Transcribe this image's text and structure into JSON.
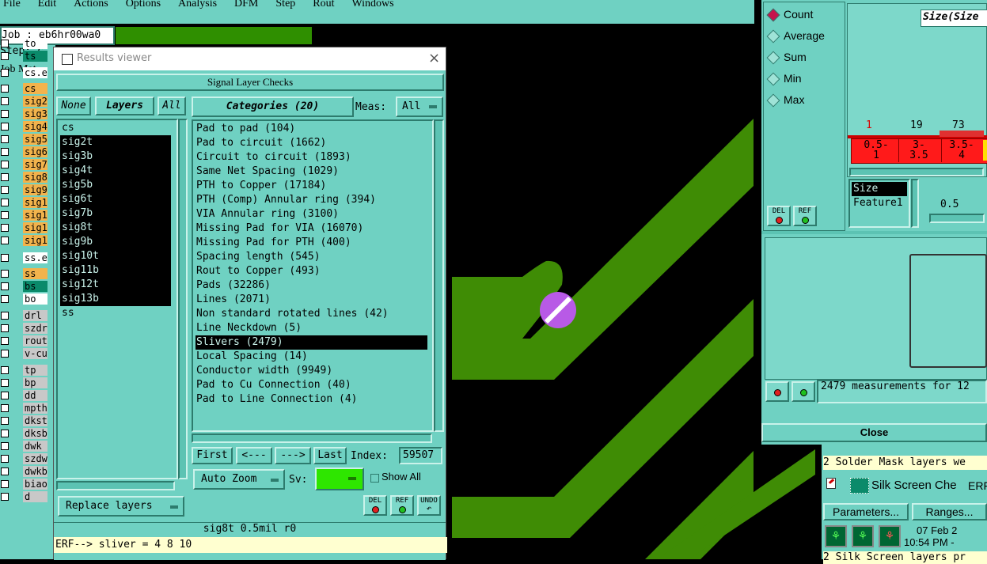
{
  "menu": [
    "File",
    "Edit",
    "Actions",
    "Options",
    "Analysis",
    "DFM",
    "Step",
    "Rout",
    "Windows"
  ],
  "job_label": "Job : eb6hr00wa0",
  "step_label": "Step: c",
  "job_matrix_label": "Job Mat",
  "left_layers": [
    {
      "name": "to",
      "color": "#ffffff"
    },
    {
      "name": "ts",
      "color": "#0a8a6a"
    },
    {
      "name": "cs.e",
      "color": "#ffffff"
    },
    {
      "name": "cs",
      "color": "#f2b34c"
    },
    {
      "name": "sig2",
      "color": "#f2b34c"
    },
    {
      "name": "sig3",
      "color": "#f2b34c"
    },
    {
      "name": "sig4",
      "color": "#f2b34c"
    },
    {
      "name": "sig5",
      "color": "#f2b34c"
    },
    {
      "name": "sig6",
      "color": "#f2b34c"
    },
    {
      "name": "sig7",
      "color": "#f2b34c"
    },
    {
      "name": "sig8",
      "color": "#f2b34c"
    },
    {
      "name": "sig9",
      "color": "#f2b34c"
    },
    {
      "name": "sig1",
      "color": "#f2b34c"
    },
    {
      "name": "sig1",
      "color": "#f2b34c"
    },
    {
      "name": "sig1",
      "color": "#f2b34c"
    },
    {
      "name": "sig1",
      "color": "#f2b34c"
    },
    {
      "name": "ss.e",
      "color": "#ffffff"
    },
    {
      "name": "ss",
      "color": "#f2b34c"
    },
    {
      "name": "bs",
      "color": "#0a8a6a"
    },
    {
      "name": "bo",
      "color": "#ffffff"
    },
    {
      "name": "drl",
      "color": "#c8c8c8"
    },
    {
      "name": "szdr",
      "color": "#c8c8c8"
    },
    {
      "name": "rout",
      "color": "#c8c8c8"
    },
    {
      "name": "v-cu",
      "color": "#c8c8c8"
    },
    {
      "name": "tp",
      "color": "#c8c8c8"
    },
    {
      "name": "bp",
      "color": "#c8c8c8"
    },
    {
      "name": "dd",
      "color": "#c8c8c8"
    },
    {
      "name": "mpth",
      "color": "#c8c8c8"
    },
    {
      "name": "dkst",
      "color": "#c8c8c8"
    },
    {
      "name": "dksb",
      "color": "#c8c8c8"
    },
    {
      "name": "dwk",
      "color": "#c8c8c8"
    },
    {
      "name": "szdw",
      "color": "#c8c8c8"
    },
    {
      "name": "dwkb",
      "color": "#c8c8c8"
    },
    {
      "name": "biao",
      "color": "#c8c8c8"
    },
    {
      "name": "d",
      "color": "#c8c8c8"
    }
  ],
  "results_viewer": {
    "title": "Results viewer",
    "header": "Signal Layer Checks",
    "none_btn": "None",
    "layers_btn": "Layers",
    "all_btn": "All",
    "layers": [
      {
        "name": "cs",
        "sel": false
      },
      {
        "name": "sig2t",
        "sel": true
      },
      {
        "name": "sig3b",
        "sel": true
      },
      {
        "name": "sig4t",
        "sel": true
      },
      {
        "name": "sig5b",
        "sel": true
      },
      {
        "name": "sig6t",
        "sel": true
      },
      {
        "name": "sig7b",
        "sel": true
      },
      {
        "name": "sig8t",
        "sel": true
      },
      {
        "name": "sig9b",
        "sel": true
      },
      {
        "name": "sig10t",
        "sel": true
      },
      {
        "name": "sig11b",
        "sel": true
      },
      {
        "name": "sig12t",
        "sel": true
      },
      {
        "name": "sig13b",
        "sel": true
      },
      {
        "name": "ss",
        "sel": false
      }
    ],
    "categories_label": "Categories (20)",
    "meas_label": "Meas:",
    "meas_value": "All",
    "categories": [
      {
        "name": "Pad to pad (104)",
        "sel": false
      },
      {
        "name": "Pad to circuit (1662)",
        "sel": false
      },
      {
        "name": "Circuit to circuit (1893)",
        "sel": false
      },
      {
        "name": "Same Net Spacing (1029)",
        "sel": false
      },
      {
        "name": "PTH to Copper (17184)",
        "sel": false
      },
      {
        "name": "PTH (Comp) Annular ring (394)",
        "sel": false
      },
      {
        "name": "VIA Annular ring (3100)",
        "sel": false
      },
      {
        "name": "Missing Pad for VIA (16070)",
        "sel": false
      },
      {
        "name": "Missing Pad for PTH (400)",
        "sel": false
      },
      {
        "name": "Spacing length (545)",
        "sel": false
      },
      {
        "name": "Rout to Copper (493)",
        "sel": false
      },
      {
        "name": "Pads (32286)",
        "sel": false
      },
      {
        "name": "Lines (2071)",
        "sel": false
      },
      {
        "name": "Non standard rotated lines (42)",
        "sel": false
      },
      {
        "name": "Line Neckdown (5)",
        "sel": false
      },
      {
        "name": "Slivers (2479)",
        "sel": true
      },
      {
        "name": "Local Spacing (14)",
        "sel": false
      },
      {
        "name": "Conductor width (9949)",
        "sel": false
      },
      {
        "name": "Pad to Cu Connection (40)",
        "sel": false
      },
      {
        "name": "Pad to Line Connection (4)",
        "sel": false
      }
    ],
    "first_btn": "First",
    "prev_btn": "<---",
    "next_btn": "--->",
    "last_btn": "Last",
    "index_label": "Index:",
    "index_value": "59507",
    "auto_zoom": "Auto Zoom",
    "sv_label": "Sv:",
    "show_all": "Show All",
    "replace_layers": "Replace layers",
    "del": "DEL",
    "ref": "REF",
    "undo": "UNDO",
    "status": "sig8t 0.5mil  r0",
    "erf_line": "ERF--> sliver = 4 8 10"
  },
  "stats_panel": {
    "radios": [
      {
        "label": "Count",
        "on": true
      },
      {
        "label": "Average",
        "on": false
      },
      {
        "label": "Sum",
        "on": false
      },
      {
        "label": "Min",
        "on": false
      },
      {
        "label": "Max",
        "on": false
      }
    ],
    "size_title": "Size(Size",
    "hist_counts": [
      "1",
      "19",
      "73"
    ],
    "hist_bins": [
      [
        "0.5-",
        "1"
      ],
      [
        "3-",
        "3.5"
      ],
      [
        "3.5-",
        "4"
      ]
    ],
    "fields": [
      "Size",
      "Feature1"
    ],
    "slider_value": "0.5",
    "del": "DEL",
    "ref": "REF",
    "measurements": "2479 measurements for 12",
    "close": "Close"
  },
  "bottom_right": {
    "line1": "2 Solder Mask layers we",
    "silk_title": "Silk Screen Che",
    "erf": "ERF:",
    "parameters": "Parameters...",
    "ranges": "Ranges...",
    "date": "07 Feb 2",
    "time": "10:54 PM -",
    "line2": "2 Silk Screen layers pr"
  }
}
